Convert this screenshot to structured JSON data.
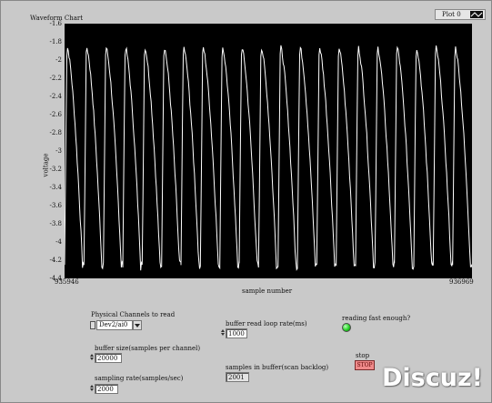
{
  "window": {
    "title": "Waveform Chart"
  },
  "plot_legend": {
    "label": "Plot 0"
  },
  "chart_data": {
    "type": "line",
    "title": "Waveform Chart",
    "xlabel": "sample number",
    "ylabel": "voltage",
    "x_range": [
      935946,
      936969
    ],
    "xticks": [
      "935946",
      "936969"
    ],
    "ylim": [
      -4.4,
      -1.6
    ],
    "yticks": [
      "-1.6",
      "-1.8",
      "-2",
      "-2.2",
      "-2.4",
      "-2.6",
      "-2.8",
      "-3",
      "-3.2",
      "-3.4",
      "-3.6",
      "-3.8",
      "-4",
      "-4.2",
      "-4.4"
    ],
    "cycles": 21,
    "peak": -1.85,
    "trough": -4.25,
    "background": "#000000",
    "trace_color": "#ffffff",
    "grid": false,
    "series": [
      {
        "name": "Plot 0",
        "waveform": "periodic sawtooth-like pulses"
      }
    ]
  },
  "controls": {
    "physical_channel": {
      "label": "Physical Channels to read",
      "value": "Dev2/ai0"
    },
    "buffer_size": {
      "label": "buffer size(samples per channel)",
      "value": "20000"
    },
    "sampling_rate": {
      "label": "sampling rate(samples/sec)",
      "value": "2000"
    },
    "loop_rate": {
      "label": "buffer read loop rate(ms)",
      "value": "1000"
    },
    "samples_in_buffer": {
      "label": "samples in buffer(scan backlog)",
      "value": "2001"
    },
    "reading_fast": {
      "label": "reading fast enough?",
      "led_color": "#27d327",
      "state": true
    },
    "stop": {
      "label": "stop",
      "button": "STOP"
    }
  },
  "watermark": {
    "text": "Discuz!"
  },
  "colors": {
    "panel": "#c9c9c9",
    "plot_bg": "#000000",
    "stop_button": "#e57373",
    "led": "#27d327"
  }
}
